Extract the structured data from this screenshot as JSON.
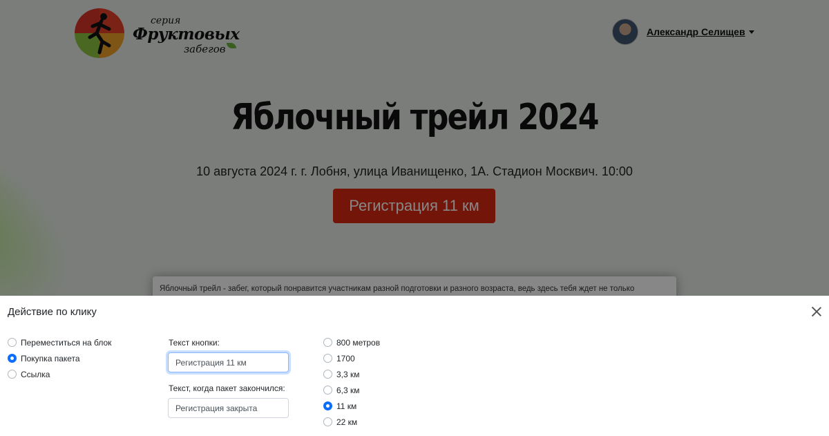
{
  "header": {
    "logo": {
      "small": "серия",
      "big": "Фруктовых",
      "sub": "забегов"
    },
    "user_name": "Александр Селищев"
  },
  "event": {
    "title": "Яблочный трейл 2024",
    "subtitle": "10 августа 2024 г. г. Лобня, улица Иванищенко, 1А. Стадион Москвич. 10:00",
    "register_button": "Регистрация 11 км",
    "description": "Яблочный трейл - забег, который понравится участникам разной подготовки и разного возраста, ведь здесь тебя ждет не только"
  },
  "panel": {
    "title": "Действие по клику",
    "action_options": [
      {
        "label": "Переместиться на блок",
        "checked": false
      },
      {
        "label": "Покупка пакета",
        "checked": true
      },
      {
        "label": "Ссылка",
        "checked": false
      }
    ],
    "button_text_label": "Текст кнопки:",
    "button_text_value": "Регистрация 11 км",
    "sold_out_label": "Текст, когда пакет закончился:",
    "sold_out_value": "Регистрация закрыта",
    "package_options": [
      {
        "label": "800 метров",
        "checked": false
      },
      {
        "label": "1700",
        "checked": false
      },
      {
        "label": "3,3 км",
        "checked": false
      },
      {
        "label": "6,3 км",
        "checked": false
      },
      {
        "label": "11 км",
        "checked": true
      },
      {
        "label": "22 км",
        "checked": false
      }
    ]
  },
  "colors": {
    "accent": "#0d6efd",
    "register_button": "#d92a12"
  }
}
